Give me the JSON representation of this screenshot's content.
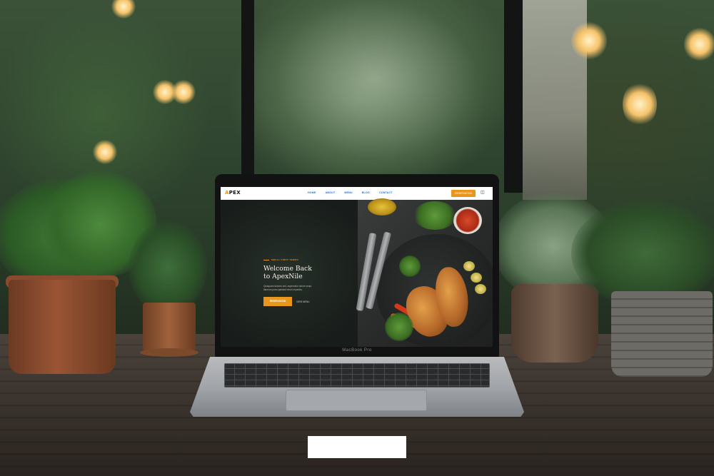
{
  "scene": {
    "laptop_model_label": "MacBook Pro"
  },
  "site": {
    "logo_text": "PEX",
    "logo_mark": "A",
    "nav": {
      "links": [
        "HOME",
        "ABOUT",
        "MENU",
        "BLOG",
        "CONTACT"
      ],
      "cta_label": "RESERVATION",
      "cart_icon": "shopping-bag-icon"
    },
    "hero": {
      "eyebrow": "SMALL FIRST TEMPO",
      "title_line_1": "Welcome Back",
      "title_line_2": "to ApexNile",
      "body": "Quisquam dolores sed, aspernatur dolore sequi laborum porro pariatur rerum expedita.",
      "primary_button": "RESERVATION",
      "secondary_link": "VIEW MENU"
    },
    "colors": {
      "accent": "#e8961c",
      "nav_link": "#2a6fc9",
      "hero_bg": "#181c1a"
    }
  }
}
